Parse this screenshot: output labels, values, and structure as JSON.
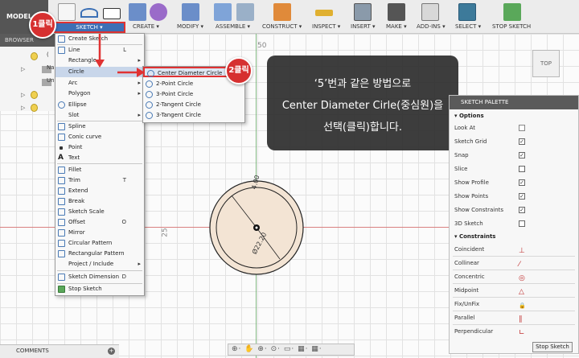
{
  "toolbar": {
    "mode_label": "MODEL",
    "sketch_tab": "SKETCH ▾",
    "groups": [
      "CREATE ▾",
      "MODIFY ▾",
      "ASSEMBLE ▾",
      "CONSTRUCT ▾",
      "INSPECT ▾",
      "INSERT ▾",
      "MAKE ▾",
      "ADD-INS ▾",
      "SELECT ▾",
      "STOP SKETCH"
    ]
  },
  "browser": {
    "title": "BROWSER",
    "rows": [
      "(",
      "Na",
      "Un",
      "",
      ""
    ]
  },
  "sketch_menu": {
    "items": [
      {
        "label": "Create Sketch",
        "shortcut": ""
      },
      {
        "label": "Line",
        "shortcut": "L"
      },
      {
        "label": "Rectangle",
        "shortcut": "",
        "sub": "▸"
      },
      {
        "label": "Circle",
        "shortcut": "",
        "sub": "▸"
      },
      {
        "label": "Arc",
        "shortcut": "",
        "sub": "▸"
      },
      {
        "label": "Polygon",
        "shortcut": "",
        "sub": "▸"
      },
      {
        "label": "Ellipse",
        "shortcut": ""
      },
      {
        "label": "Slot",
        "shortcut": "",
        "sub": "▸"
      },
      {
        "label": "Spline",
        "shortcut": ""
      },
      {
        "label": "Conic curve",
        "shortcut": ""
      },
      {
        "label": "Point",
        "shortcut": ""
      },
      {
        "label": "Text",
        "shortcut": ""
      },
      {
        "label": "Fillet",
        "shortcut": ""
      },
      {
        "label": "Trim",
        "shortcut": "T"
      },
      {
        "label": "Extend",
        "shortcut": ""
      },
      {
        "label": "Break",
        "shortcut": ""
      },
      {
        "label": "Sketch Scale",
        "shortcut": ""
      },
      {
        "label": "Offset",
        "shortcut": "O"
      },
      {
        "label": "Mirror",
        "shortcut": ""
      },
      {
        "label": "Circular Pattern",
        "shortcut": ""
      },
      {
        "label": "Rectangular Pattern",
        "shortcut": ""
      },
      {
        "label": "Project / Include",
        "shortcut": "",
        "sub": "▸"
      },
      {
        "label": "Sketch Dimension",
        "shortcut": "D"
      },
      {
        "label": "Stop Sketch",
        "shortcut": ""
      }
    ]
  },
  "circle_menu": {
    "items": [
      "Center Diameter Circle",
      "2-Point Circle",
      "3-Point Circle",
      "2-Tangent Circle",
      "3-Tangent Circle"
    ]
  },
  "callouts": {
    "step1": "1클릭",
    "step2": "2클릭"
  },
  "note": {
    "line1": "‘5’번과 같은 방법으로",
    "line2": "Center Diameter Cirle(중심원)을",
    "line3": "선택(클릭)합니다."
  },
  "palette": {
    "title": "SKETCH PALETTE",
    "options_title": "Options",
    "options": [
      {
        "label": "Look At",
        "checked": null
      },
      {
        "label": "Sketch Grid",
        "checked": true
      },
      {
        "label": "Snap",
        "checked": true
      },
      {
        "label": "Slice",
        "checked": false
      },
      {
        "label": "Show Profile",
        "checked": true
      },
      {
        "label": "Show Points",
        "checked": true
      },
      {
        "label": "Show Constraints",
        "checked": true
      },
      {
        "label": "3D Sketch",
        "checked": false
      }
    ],
    "constraints_title": "Constraints",
    "constraints": [
      {
        "label": "Coincident",
        "icon": "coincident-icon",
        "glyph": "⊥"
      },
      {
        "label": "Collinear",
        "icon": "collinear-icon",
        "glyph": "⁄"
      },
      {
        "label": "Concentric",
        "icon": "concentric-icon",
        "glyph": "◎"
      },
      {
        "label": "Midpoint",
        "icon": "midpoint-icon",
        "glyph": "△"
      },
      {
        "label": "Fix/UnFix",
        "icon": "lock-icon",
        "glyph": "🔒"
      },
      {
        "label": "Parallel",
        "icon": "parallel-icon",
        "glyph": "∥"
      },
      {
        "label": "Perpendicular",
        "icon": "perpendicular-icon",
        "glyph": "∟"
      }
    ],
    "stop_button": "Stop Sketch"
  },
  "viewcube": {
    "label": "TOP"
  },
  "canvas": {
    "tick_50": "50",
    "tick_25": "25",
    "dim_radius": "4.00",
    "dim_diameter": "Ø22.20"
  },
  "comments": {
    "label": "COMMENTS"
  },
  "navbar": {
    "icons": "⊕· ✋ ⊕· ⊙· ▭· ▦· ▦·"
  }
}
